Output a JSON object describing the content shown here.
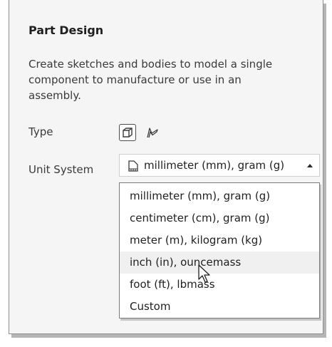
{
  "panel": {
    "title": "Part Design",
    "description": "Create sketches and bodies to model a single component to manufacture or use in an assembly."
  },
  "type_row": {
    "label": "Type",
    "options": [
      {
        "icon": "solid-body-icon",
        "selected": true
      },
      {
        "icon": "sheet-metal-icon",
        "selected": false
      }
    ]
  },
  "unit_system": {
    "label": "Unit System",
    "selected": "millimeter (mm), gram (g)",
    "options": [
      "millimeter (mm), gram (g)",
      "centimeter (cm), gram (g)",
      "meter (m), kilogram (kg)",
      "inch (in), ouncemass",
      "foot (ft), lbmass",
      "Custom"
    ],
    "hovered_option": "inch (in), ouncemass"
  },
  "colors": {
    "panel_bg": "#f5f5f5",
    "hover_bg": "#f0f0f0",
    "text": "#1f1f1f"
  }
}
